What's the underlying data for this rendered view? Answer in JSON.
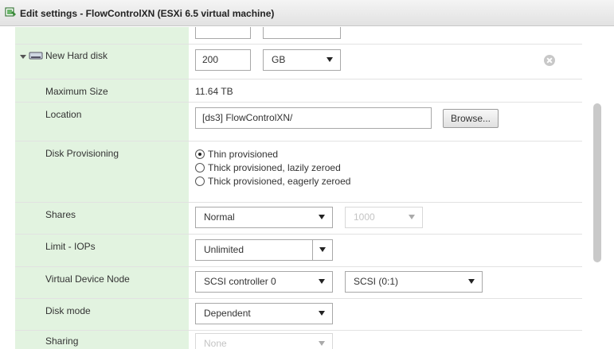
{
  "window": {
    "title": "Edit settings - FlowControlXN (ESXi 6.5 virtual machine)"
  },
  "disk": {
    "name": "New Hard disk",
    "size_value": "200",
    "size_unit": "GB",
    "max_size_label": "Maximum Size",
    "max_size_value": "11.64 TB",
    "location_label": "Location",
    "location_value": "[ds3] FlowControlXN/",
    "browse_label": "Browse...",
    "provisioning_label": "Disk Provisioning",
    "provisioning_options": [
      {
        "label": "Thin provisioned",
        "selected": true
      },
      {
        "label": "Thick provisioned, lazily zeroed",
        "selected": false
      },
      {
        "label": "Thick provisioned, eagerly zeroed",
        "selected": false
      }
    ],
    "shares_label": "Shares",
    "shares_value": "Normal",
    "shares_number": "1000",
    "limit_label": "Limit - IOPs",
    "limit_value": "Unlimited",
    "vdn_label": "Virtual Device Node",
    "vdn_controller": "SCSI controller 0",
    "vdn_slot": "SCSI (0:1)",
    "disk_mode_label": "Disk mode",
    "disk_mode_value": "Dependent",
    "sharing_label": "Sharing",
    "sharing_value": "None"
  },
  "icons": {
    "app": "vm-edit-icon",
    "disk": "hard-disk-icon",
    "expand": "caret-down-icon",
    "remove": "remove-circle-icon"
  },
  "colors": {
    "label_bg": "#e2f3e0",
    "border": "#a8a8a8"
  }
}
